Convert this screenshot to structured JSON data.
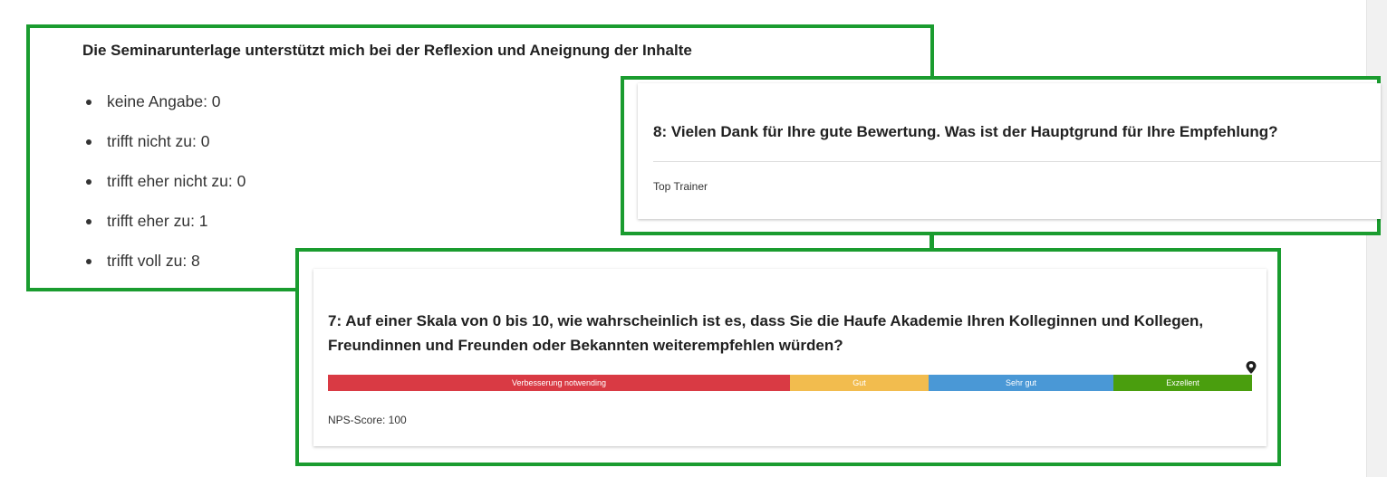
{
  "card_reflexion": {
    "title": "Die Seminarunterlage unterstützt mich bei der Reflexion und Aneignung der Inhalte",
    "items": [
      "keine Angabe: 0",
      "trifft nicht zu: 0",
      "trifft eher nicht zu: 0",
      "trifft eher zu: 1",
      "trifft voll zu: 8"
    ]
  },
  "card_empfehlung": {
    "title": "8: Vielen Dank für Ihre gute Bewertung. Was ist der Hauptgrund für Ihre Empfehlung?",
    "answer": "Top Trainer"
  },
  "card_nps": {
    "question": "7: Auf einer Skala von 0 bis 10, wie wahrscheinlich ist es, dass Sie die Haufe Akademie Ihren Kolleginnen und Kollegen, Freundinnen und Freunden oder Bekannten weiterempfehlen würden?",
    "marker_icon": "map-pin-icon",
    "score_text": "NPS-Score: 100",
    "segments": [
      {
        "label": "Verbesserung notwending",
        "color": "#d93a44",
        "share": 0.5
      },
      {
        "label": "Gut",
        "color": "#f2bc4e",
        "share": 0.15
      },
      {
        "label": "Sehr gut",
        "color": "#4a98d6",
        "share": 0.2
      },
      {
        "label": "Exzellent",
        "color": "#4a9e0e",
        "share": 0.15
      }
    ]
  },
  "highlight_color": "#1a9c2f"
}
